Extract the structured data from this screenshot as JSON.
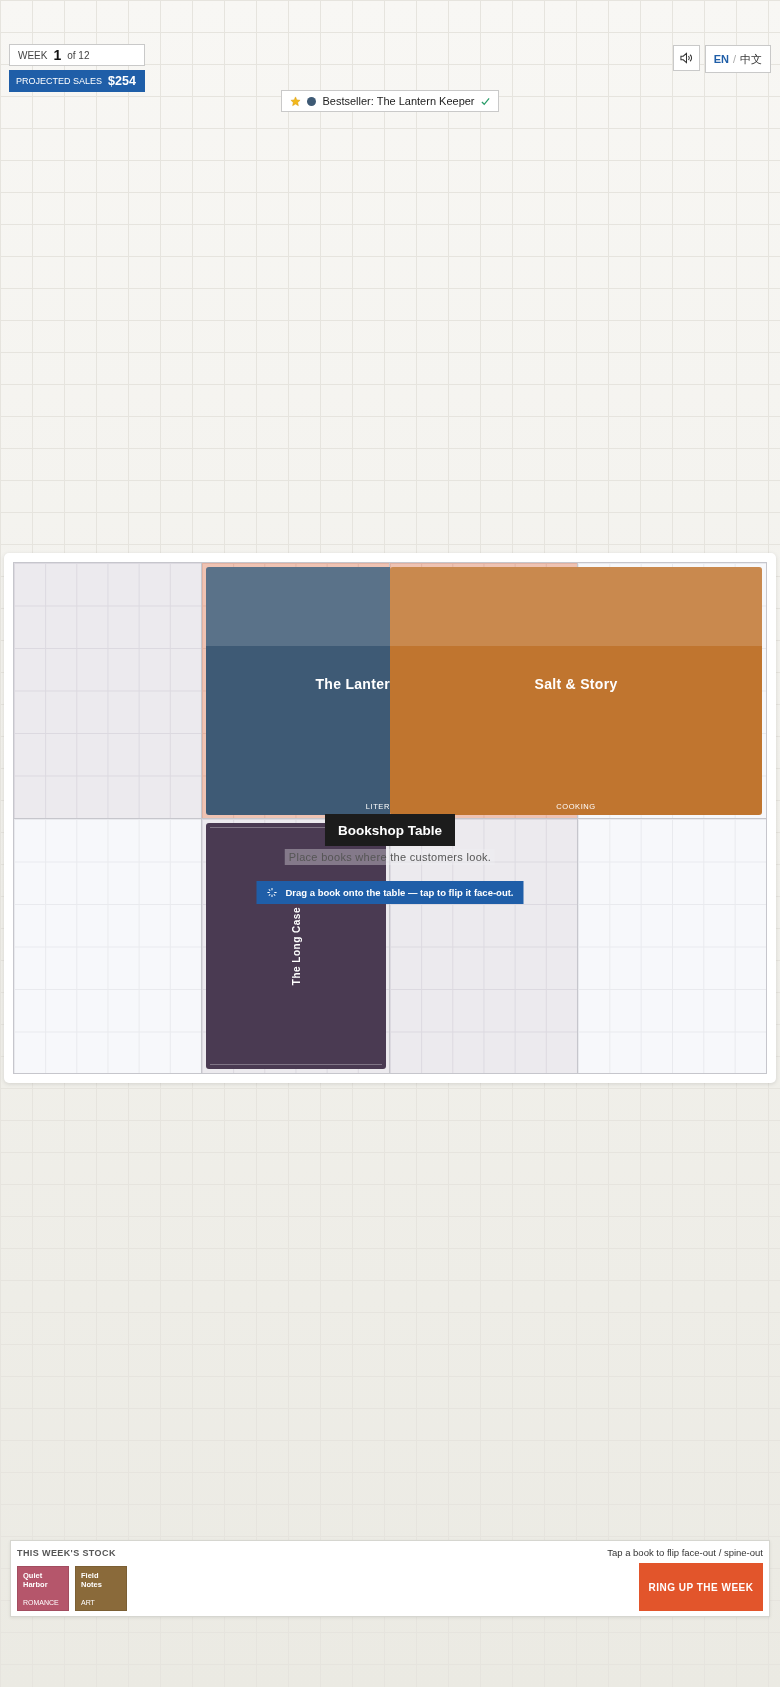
{
  "header": {
    "week_label": "WEEK",
    "week": "1",
    "week_total": "of 12",
    "sales_label": "PROJECTED SALES",
    "sales": "$254"
  },
  "language": {
    "separator": "/",
    "options": [
      {
        "label": "EN",
        "selected": true
      },
      {
        "label": "中文",
        "selected": false
      }
    ]
  },
  "bestseller": {
    "text": "Bestseller: The Lantern Keeper",
    "color": "#3e5a75",
    "done": true
  },
  "table": {
    "title": "Bookshop Table",
    "hint": "Place books where the customers look.",
    "tip": "Drag a book onto the table — tap to flip it face-out.",
    "zones": [
      {
        "kind": "dim"
      },
      {
        "kind": "target",
        "books": [
          {
            "title": "The Lanter",
            "genre": "LITER",
            "kind": "face-out",
            "color": "#3e5a75"
          }
        ]
      },
      {
        "kind": "target",
        "books": [
          {
            "title": "Salt & Story",
            "genre": "COOKING",
            "kind": "face-out",
            "color": "#c0752f"
          }
        ]
      },
      {
        "kind": "plain"
      },
      {
        "kind": "plain"
      },
      {
        "kind": "dim",
        "books": [
          {
            "title": "The Long Case",
            "kind": "spine-out",
            "color": "#4a3a52"
          }
        ]
      },
      {
        "kind": "dim"
      },
      {
        "kind": "plain"
      }
    ]
  },
  "stock": {
    "title": "THIS WEEK'S STOCK",
    "hint": "Tap a book to flip face-out / spine-out",
    "button": "RING UP THE WEEK",
    "books": [
      {
        "title": "Quiet Harbor",
        "genre": "ROMANCE",
        "color": "#b5566b"
      },
      {
        "title": "Field Notes",
        "genre": "ART",
        "color": "#8a6a3a"
      }
    ]
  }
}
